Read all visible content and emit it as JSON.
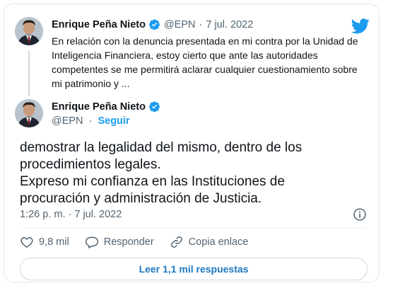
{
  "colors": {
    "accent": "#1d9bf0",
    "text": "#0f1419",
    "muted": "#536471",
    "border": "#cfd9de"
  },
  "quoted_tweet": {
    "author_name": "Enrique Peña Nieto",
    "handle": "@EPN",
    "separator": "·",
    "date": "7 jul. 2022",
    "text": "En relación con la denuncia presentada en mi contra por la Unidad de Inteligencia Financiera,  estoy cierto que ante las autoridades competentes se me permitirá aclarar cualquier cuestionamiento sobre mi patrimonio y ..."
  },
  "main_tweet": {
    "author_name": "Enrique Peña Nieto",
    "handle": "@EPN",
    "separator": "·",
    "follow_label": "Seguir",
    "text_lines": [
      "demostrar la legalidad del mismo, dentro de los",
      "procedimientos  legales.",
      "Expreso mi confianza en las Instituciones de",
      "procuración y administración de Justicia."
    ],
    "timestamp": "1:26 p. m. · 7 jul. 2022"
  },
  "actions": {
    "likes_count": "9,8 mil",
    "reply_label": "Responder",
    "copy_link_label": "Copia enlace"
  },
  "read_replies_label": "Leer 1,1 mil respuestas",
  "icons": [
    "twitter-logo-icon",
    "verified-badge-icon",
    "info-icon",
    "heart-icon",
    "reply-bubble-icon",
    "link-icon"
  ]
}
